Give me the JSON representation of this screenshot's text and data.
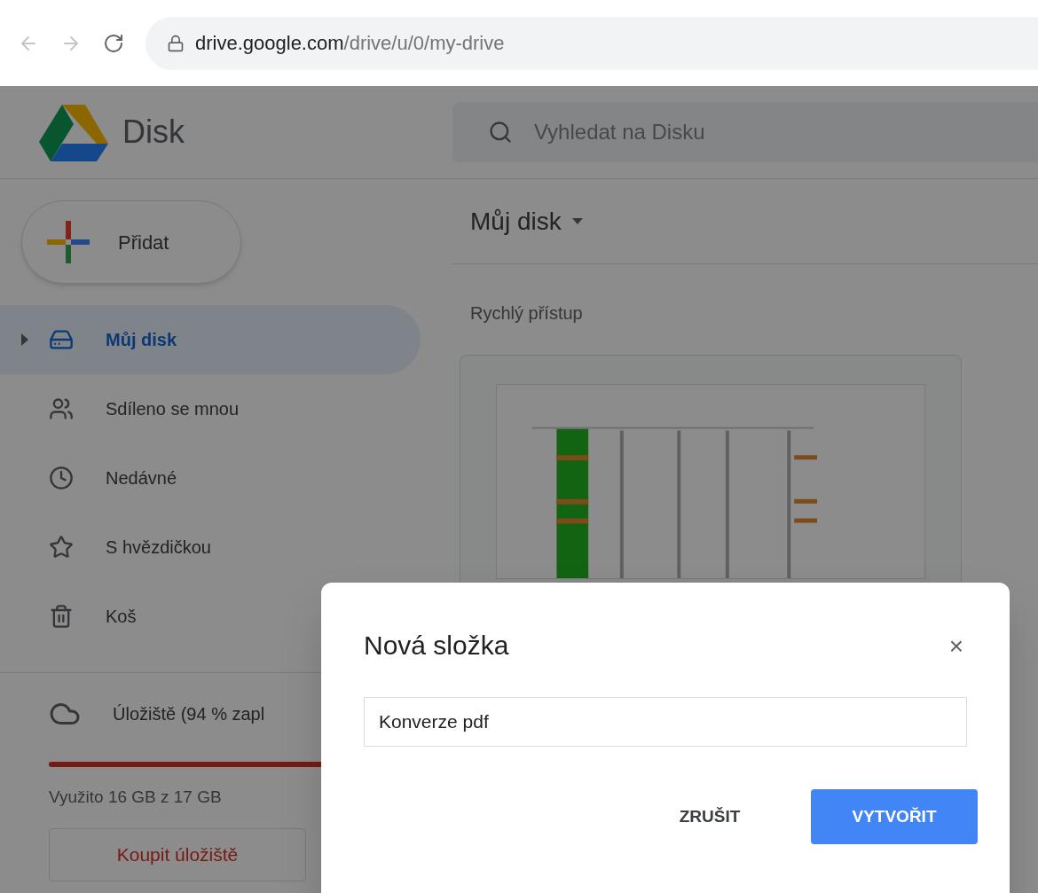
{
  "browser": {
    "url_host": "drive.google.com",
    "url_path": "/drive/u/0/my-drive"
  },
  "header": {
    "app_name": "Disk",
    "search": {
      "placeholder": "Vyhledat na Disku"
    }
  },
  "sidebar": {
    "new_button": "Přidat",
    "items": [
      {
        "label": "Můj disk",
        "selected": true,
        "expandable": true
      },
      {
        "label": "Sdíleno se mnou",
        "selected": false,
        "expandable": false
      },
      {
        "label": "Nedávné",
        "selected": false,
        "expandable": false
      },
      {
        "label": "S hvězdičkou",
        "selected": false,
        "expandable": false
      },
      {
        "label": "Koš",
        "selected": false,
        "expandable": false
      }
    ],
    "storage": {
      "label": "Úložiště (94 % zapl",
      "level": 0.94,
      "usage": "Využito 16 GB z 17 GB",
      "buy_button": "Koupit úložiště"
    }
  },
  "main": {
    "title": "Můj disk",
    "section": "Rychlý přístup"
  },
  "dialog": {
    "title": "Nová složka",
    "close": "×",
    "input_value": "Konverze pdf",
    "buttons": [
      {
        "label": "ZRUŠIT",
        "kind": "text"
      },
      {
        "label": "VYTVOŘIT",
        "kind": "primary"
      }
    ]
  }
}
